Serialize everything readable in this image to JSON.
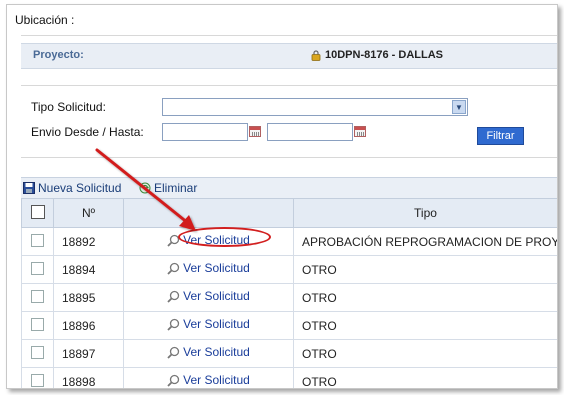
{
  "location_label": "Ubicación :",
  "project": {
    "label": "Proyecto:",
    "value": "10DPN-8176 - DALLAS"
  },
  "filters": {
    "tipo_label": "Tipo Solicitud:",
    "tipo_value": "",
    "envio_label": "Envio Desde / Hasta:",
    "desde_value": "",
    "hasta_value": "",
    "filter_button": "Filtrar"
  },
  "toolbar": {
    "new_label": "Nueva Solicitud",
    "delete_label": "Eliminar"
  },
  "table": {
    "headers": {
      "number": "Nº",
      "tipo": "Tipo"
    },
    "rows": [
      {
        "number": "18892",
        "link": "Ver Solicitud",
        "tipo": "APROBACIÓN REPROGRAMACION DE PROYECTO"
      },
      {
        "number": "18894",
        "link": "Ver Solicitud",
        "tipo": "OTRO"
      },
      {
        "number": "18895",
        "link": "Ver Solicitud",
        "tipo": "OTRO"
      },
      {
        "number": "18896",
        "link": "Ver Solicitud",
        "tipo": "OTRO"
      },
      {
        "number": "18897",
        "link": "Ver Solicitud",
        "tipo": "OTRO"
      },
      {
        "number": "18898",
        "link": "Ver Solicitud",
        "tipo": "OTRO"
      }
    ]
  },
  "annotation": {
    "color": "#d21f1f",
    "target": "row-0-ver-solicitud"
  },
  "colors": {
    "accent": "#2f6ad0",
    "header_text": "#4a6a96",
    "link": "#1a3d9a"
  }
}
